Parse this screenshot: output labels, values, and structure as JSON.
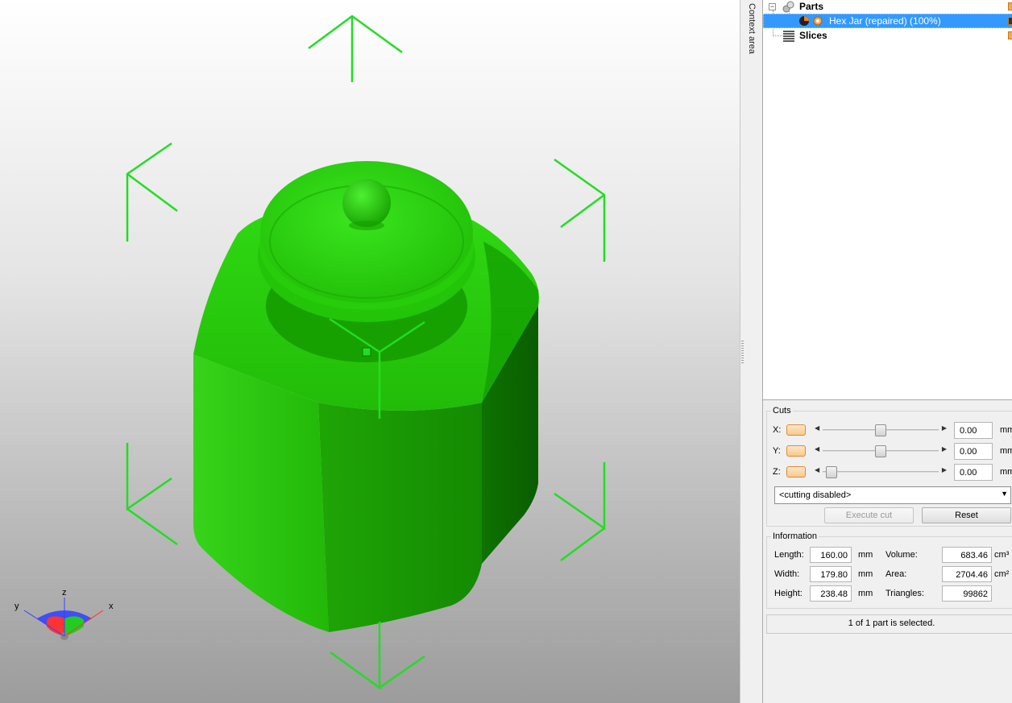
{
  "context_area": {
    "label": "Context area"
  },
  "tree": {
    "items": [
      {
        "label": "Parts",
        "expander": "−"
      },
      {
        "label": "Hex Jar (repaired) (100%)",
        "selected": true
      },
      {
        "label": "Slices"
      }
    ]
  },
  "cuts": {
    "title": "Cuts",
    "rows": [
      {
        "axis": "X:",
        "value": "0.00",
        "unit": "mm",
        "slider_position": 0.5
      },
      {
        "axis": "Y:",
        "value": "0.00",
        "unit": "mm",
        "slider_position": 0.5
      },
      {
        "axis": "Z:",
        "value": "0.00",
        "unit": "mm",
        "slider_position": 0.1
      }
    ],
    "mode": "<cutting disabled>",
    "execute_label": "Execute cut",
    "reset_label": "Reset"
  },
  "information": {
    "title": "Information",
    "length_label": "Length:",
    "length_value": "160.00",
    "length_unit": "mm",
    "width_label": "Width:",
    "width_value": "179.80",
    "width_unit": "mm",
    "height_label": "Height:",
    "height_value": "238.48",
    "height_unit": "mm",
    "volume_label": "Volume:",
    "volume_value": "683.46",
    "volume_unit": "cm³",
    "area_label": "Area:",
    "area_value": "2704.46",
    "area_unit": "cm²",
    "triangles_label": "Triangles:",
    "triangles_value": "99862"
  },
  "status": {
    "text": "1 of 1 part is selected."
  },
  "axis_gizmo": {
    "x": "x",
    "y": "y",
    "z": "z"
  },
  "colors": {
    "model": "#1fcc00",
    "selection": "#3399ff",
    "bbox": "#22dd22"
  }
}
